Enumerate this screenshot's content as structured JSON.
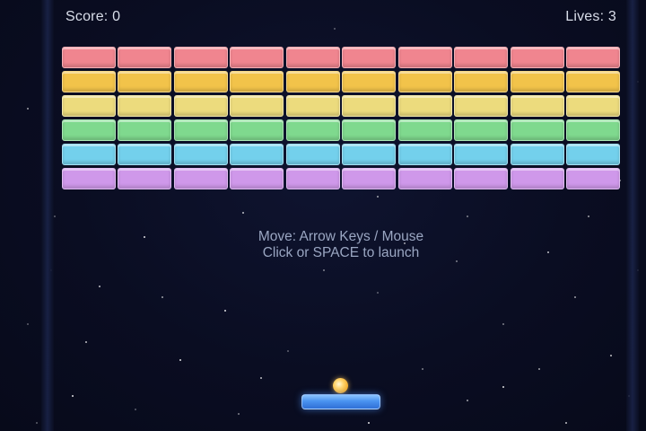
{
  "hud": {
    "score_label": "Score: 0",
    "lives_label": "Lives: 3",
    "score": 0,
    "lives": 3
  },
  "instructions": {
    "line1": "Move: Arrow Keys / Mouse",
    "line2": "Click or SPACE to launch"
  },
  "bricks": {
    "columns": 10,
    "rows": [
      {
        "color": "#f0858f"
      },
      {
        "color": "#f2c34a"
      },
      {
        "color": "#ecdb7d"
      },
      {
        "color": "#7fd98e"
      },
      {
        "color": "#73d0ec"
      },
      {
        "color": "#cf98ea"
      }
    ]
  },
  "colors": {
    "background": "#0b0f24",
    "paddle": "#4a93f0",
    "ball": "#ffc24a",
    "text": "#d9deea",
    "instructions_text": "#9aa6c2"
  }
}
